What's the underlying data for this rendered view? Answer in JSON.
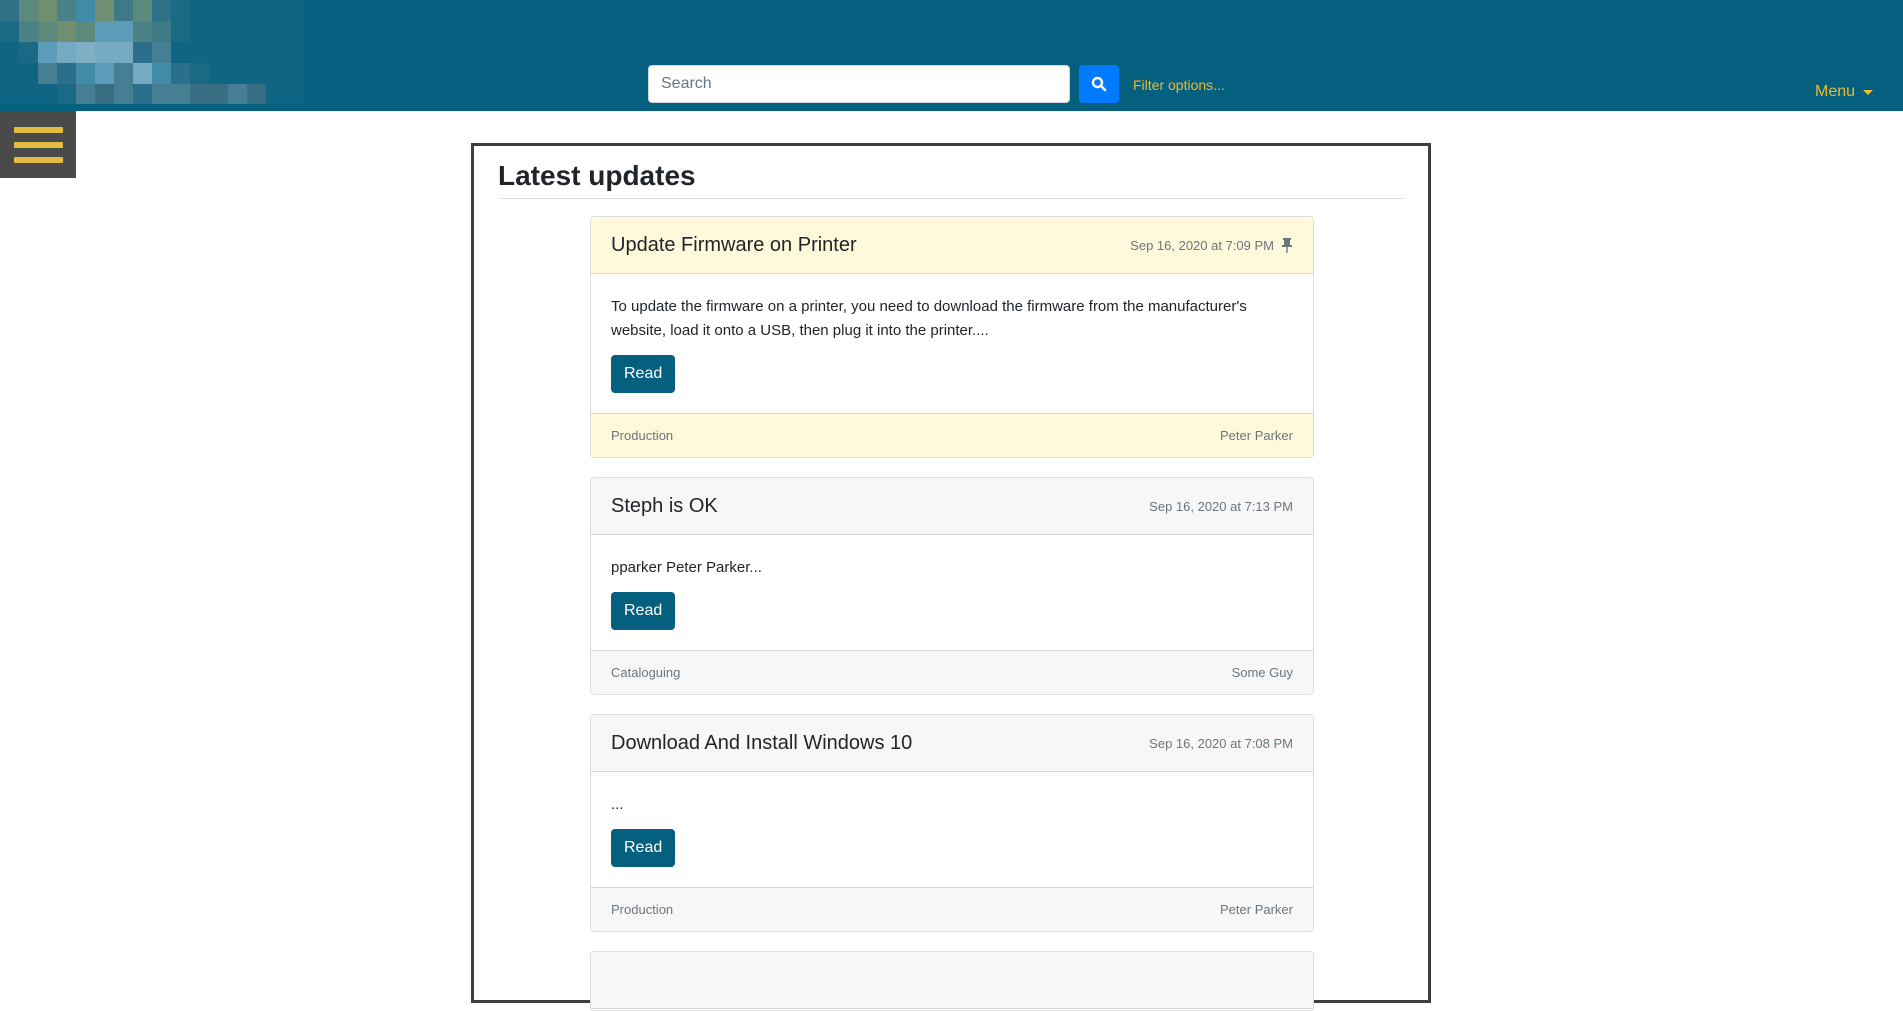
{
  "header": {
    "search": {
      "placeholder": "Search",
      "value": ""
    },
    "filter_label": "Filter options...",
    "menu_label": "Menu"
  },
  "main": {
    "title": "Latest updates",
    "posts": [
      {
        "title": "Update Firmware on Printer",
        "date": "Sep 16, 2020 at 7:09 PM",
        "pinned": true,
        "excerpt": "To update the firmware on a printer, you need to download the firmware from the manufacturer's website, load it onto a USB, then plug it into the printer....",
        "read_label": "Read",
        "category": "Production",
        "author": "Peter Parker"
      },
      {
        "title": "Steph is OK",
        "date": "Sep 16, 2020 at 7:13 PM",
        "pinned": false,
        "excerpt": "pparker Peter Parker...",
        "read_label": "Read",
        "category": "Cataloguing",
        "author": "Some Guy"
      },
      {
        "title": "Download And Install Windows 10",
        "date": "Sep 16, 2020 at 7:08 PM",
        "pinned": false,
        "excerpt": "...",
        "read_label": "Read",
        "category": "Production",
        "author": "Peter Parker"
      }
    ]
  },
  "colors": {
    "header_bg": "#05607f",
    "accent": "#f0b92e",
    "search_button": "#007bff",
    "read_button": "#05607f",
    "pinned_bg": "#fff9dc"
  },
  "icons": {
    "search": "search-icon",
    "pin": "pin-icon",
    "menu": "hamburger-icon",
    "caret": "caret-down-icon"
  }
}
